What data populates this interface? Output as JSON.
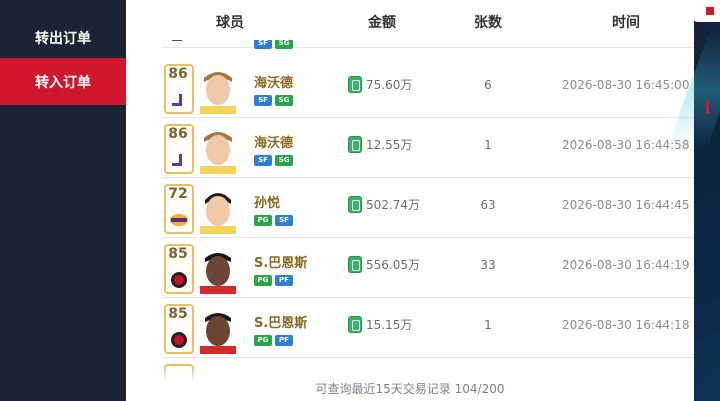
{
  "sidebar": {
    "items": [
      {
        "label": "转出订单",
        "active": false
      },
      {
        "label": "转入订单",
        "active": true
      }
    ]
  },
  "table": {
    "headers": {
      "player": "球员",
      "amount": "金额",
      "count": "张数",
      "time": "时间"
    },
    "rows": [
      {
        "rating": "86",
        "team": "jazz",
        "name": "海沃德",
        "positions": [
          "SF",
          "SG"
        ],
        "amount": "75.60万",
        "count": "6",
        "time": "2026-08-30 16:45:00"
      },
      {
        "rating": "86",
        "team": "jazz",
        "name": "海沃德",
        "positions": [
          "SF",
          "SG"
        ],
        "amount": "12.55万",
        "count": "1",
        "time": "2026-08-30 16:44:58"
      },
      {
        "rating": "72",
        "team": "lakers",
        "name": "孙悦",
        "positions": [
          "PG",
          "SF"
        ],
        "amount": "502.74万",
        "count": "63",
        "time": "2026-08-30 16:44:45"
      },
      {
        "rating": "85",
        "team": "raptors",
        "name": "S.巴恩斯",
        "positions": [
          "PG",
          "PF"
        ],
        "amount": "556.05万",
        "count": "33",
        "time": "2026-08-30 16:44:19"
      },
      {
        "rating": "85",
        "team": "raptors",
        "name": "S.巴恩斯",
        "positions": [
          "PG",
          "PF"
        ],
        "amount": "15.15万",
        "count": "1",
        "time": "2026-08-30 16:44:18"
      }
    ],
    "partial_top": {
      "positions": [
        "SF",
        "SG"
      ]
    }
  },
  "footer": {
    "text": "可查询最近15天交易记录 104/200"
  },
  "colors": {
    "accent": "#d0172d",
    "gold": "#e5c067",
    "sidebar": "#1a2433"
  }
}
